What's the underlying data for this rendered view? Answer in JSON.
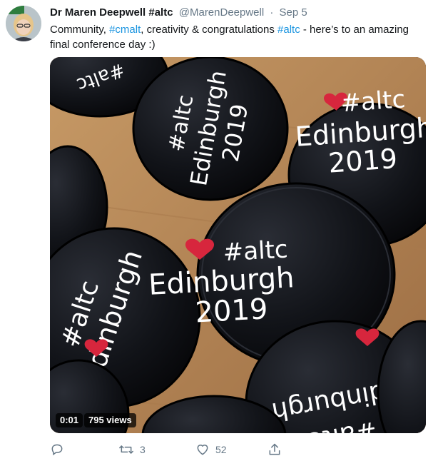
{
  "tweet": {
    "author_name": "Dr Maren Deepwell #altc",
    "handle": "@MarenDeepwell",
    "separator": "·",
    "date": "Sep 5",
    "text": {
      "t1": "Community, ",
      "h1": "#cmalt",
      "t2": ", creativity & congratulations ",
      "h2": "#altc",
      "t3": " - here’s to an amazing final conference day :)"
    }
  },
  "media": {
    "time": "0:01",
    "views": "795 views",
    "badges": {
      "hashtag": "#altc",
      "city": "Edinburgh",
      "year": "2019"
    }
  },
  "actions": {
    "reply_icon": "reply-icon",
    "retweet_icon": "retweet-icon",
    "retweet_count": "3",
    "like_icon": "heart-icon",
    "like_count": "52",
    "share_icon": "share-icon"
  },
  "colors": {
    "link": "#1b95e0",
    "muted": "#657786",
    "badge_black": "#0c0c0f",
    "heart_red": "#d7263d",
    "wood": "#b88a5a"
  }
}
